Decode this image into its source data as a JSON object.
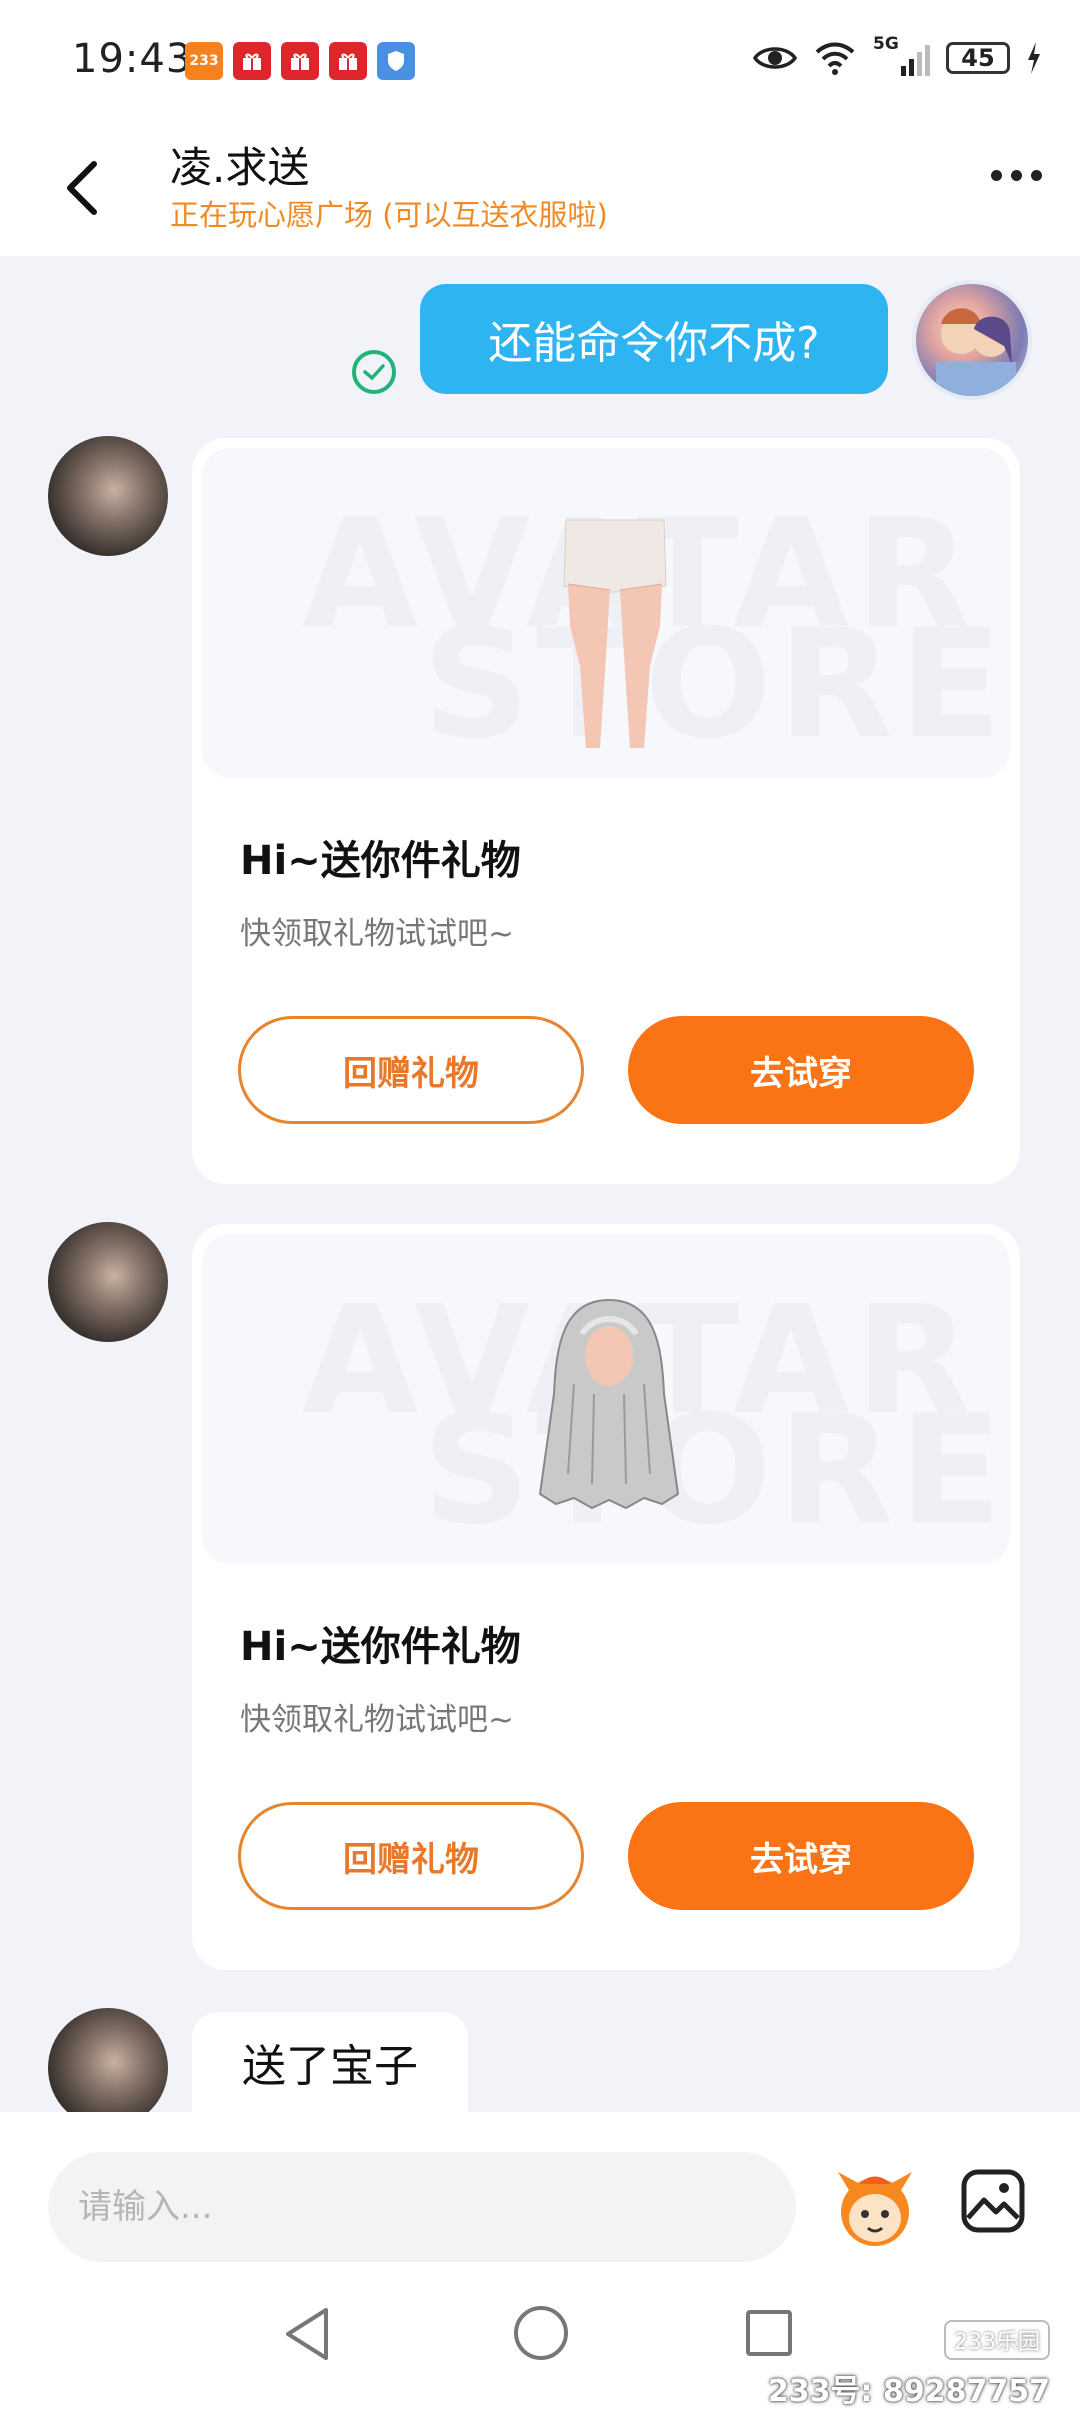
{
  "status_bar": {
    "time": "19:43",
    "notif_icons": [
      "233-app-icon",
      "gift-app-icon",
      "gift-app-icon",
      "gift-app-icon",
      "shield-app-icon"
    ],
    "notif_badge_text": "233",
    "network": "5G",
    "battery": "45"
  },
  "header": {
    "title": "凌.求送",
    "subtitle": "正在玩心愿广场 (可以互送衣服啦)"
  },
  "messages": {
    "self_text": "还能命令你不成?",
    "gift_cards": [
      {
        "watermark_line1": "AVATAR",
        "watermark_line2": "STORE",
        "item": "shorts-legs-item",
        "title": "Hi~送你件礼物",
        "desc": "快领取礼物试试吧~",
        "btn_outline": "回赠礼物",
        "btn_fill": "去试穿"
      },
      {
        "watermark_line1": "AVATAR",
        "watermark_line2": "STORE",
        "item": "long-hair-item",
        "title": "Hi~送你件礼物",
        "desc": "快领取礼物试试吧~",
        "btn_outline": "回赠礼物",
        "btn_fill": "去试穿"
      }
    ],
    "other_text": "送了宝子"
  },
  "input_bar": {
    "placeholder": "请输入..."
  },
  "watermark": {
    "logo": "233乐园",
    "text": "233号: 89287757"
  },
  "colors": {
    "accent_orange": "#fa7416",
    "subtitle_orange": "#f08a24",
    "bubble_blue": "#2fb4f2",
    "check_green": "#1fb37a"
  }
}
